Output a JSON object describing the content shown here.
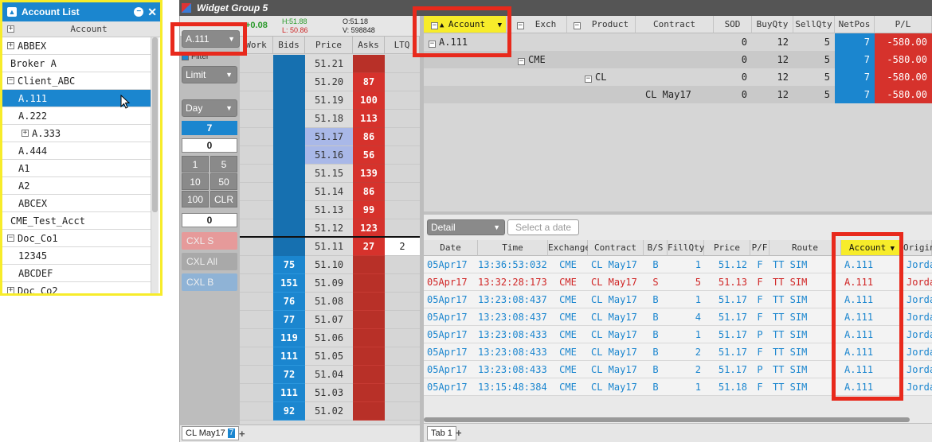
{
  "account_list": {
    "title": "Account List",
    "column": "Account",
    "rows": [
      {
        "label": "ABBEX",
        "level": 0,
        "toggle": "+"
      },
      {
        "label": "Broker A",
        "level": 0,
        "toggle": ""
      },
      {
        "label": "Client_ABC",
        "level": 0,
        "toggle": "−"
      },
      {
        "label": "A.111",
        "level": 1,
        "toggle": "",
        "selected": true
      },
      {
        "label": "A.222",
        "level": 1,
        "toggle": ""
      },
      {
        "label": "A.333",
        "level": 1,
        "toggle": "+"
      },
      {
        "label": "A.444",
        "level": 1,
        "toggle": ""
      },
      {
        "label": "A1",
        "level": 1,
        "toggle": ""
      },
      {
        "label": "A2",
        "level": 1,
        "toggle": ""
      },
      {
        "label": "ABCEX",
        "level": 1,
        "toggle": ""
      },
      {
        "label": "CME_Test_Acct",
        "level": 0,
        "toggle": ""
      },
      {
        "label": "Doc_Co1",
        "level": 0,
        "toggle": "−"
      },
      {
        "label": "12345",
        "level": 1,
        "toggle": ""
      },
      {
        "label": "ABCDEF",
        "level": 1,
        "toggle": ""
      },
      {
        "label": "Doc_Co2",
        "level": 0,
        "toggle": "+"
      }
    ]
  },
  "widget": {
    "title": "Widget Group 5"
  },
  "md": {
    "change": "+0.08",
    "high": "H:51.88",
    "low": "L: 50.86",
    "open": "O:51.18",
    "volume": "V: 598848",
    "account": "A.111",
    "filter": "Filter",
    "order_type": "Limit",
    "tif": "Day",
    "qty": "7",
    "disclosed": "0",
    "quick_qty": [
      "1",
      "5",
      "10",
      "50",
      "100",
      "CLR"
    ],
    "qty2": "0",
    "cxl_s": "CXL S",
    "cxl_all": "CXL All",
    "cxl_b": "CXL B",
    "headers": [
      "Work",
      "Bids",
      "Price",
      "Asks",
      "LTQ"
    ],
    "ladder": [
      {
        "price": "51.21",
        "bid": "",
        "ask": ""
      },
      {
        "price": "51.20",
        "bid": "",
        "ask": "87"
      },
      {
        "price": "51.19",
        "bid": "",
        "ask": "100"
      },
      {
        "price": "51.18",
        "bid": "",
        "ask": "113"
      },
      {
        "price": "51.17",
        "bid": "",
        "ask": "86"
      },
      {
        "price": "51.16",
        "bid": "",
        "ask": "56"
      },
      {
        "price": "51.15",
        "bid": "",
        "ask": "139"
      },
      {
        "price": "51.14",
        "bid": "",
        "ask": "86"
      },
      {
        "price": "51.13",
        "bid": "",
        "ask": "99"
      },
      {
        "price": "51.12",
        "bid": "",
        "ask": "123"
      },
      {
        "price": "51.11",
        "bid": "",
        "ask": "27",
        "ltq": "2"
      },
      {
        "price": "51.10",
        "bid": "75",
        "ask": ""
      },
      {
        "price": "51.09",
        "bid": "151",
        "ask": ""
      },
      {
        "price": "51.08",
        "bid": "76",
        "ask": ""
      },
      {
        "price": "51.07",
        "bid": "77",
        "ask": ""
      },
      {
        "price": "51.06",
        "bid": "119",
        "ask": ""
      },
      {
        "price": "51.05",
        "bid": "111",
        "ask": ""
      },
      {
        "price": "51.04",
        "bid": "72",
        "ask": ""
      },
      {
        "price": "51.03",
        "bid": "111",
        "ask": ""
      },
      {
        "price": "51.02",
        "bid": "92",
        "ask": ""
      }
    ],
    "tab": "CL May17",
    "tab_badge": "7"
  },
  "positions": {
    "headers": [
      "Account",
      "Exch",
      "Product",
      "Contract",
      "SOD",
      "BuyQty",
      "SellQty",
      "NetPos",
      "P/L"
    ],
    "rows": [
      {
        "account": "A.111",
        "exch": "",
        "product": "",
        "contract": "",
        "sod": "0",
        "buy": "12",
        "sell": "5",
        "net": "7",
        "pl": "-580.00"
      },
      {
        "account": "",
        "exch": "CME",
        "product": "",
        "contract": "",
        "sod": "0",
        "buy": "12",
        "sell": "5",
        "net": "7",
        "pl": "-580.00"
      },
      {
        "account": "",
        "exch": "",
        "product": "CL",
        "contract": "",
        "sod": "0",
        "buy": "12",
        "sell": "5",
        "net": "7",
        "pl": "-580.00"
      },
      {
        "account": "",
        "exch": "",
        "product": "",
        "contract": "CL May17",
        "sod": "0",
        "buy": "12",
        "sell": "5",
        "net": "7",
        "pl": "-580.00"
      }
    ]
  },
  "fills": {
    "view": "Detail",
    "date_placeholder": "Select a date",
    "headers": [
      "Date",
      "Time",
      "Exchange",
      "Contract",
      "B/S",
      "FillQty",
      "Price",
      "P/F",
      "Route",
      "Account",
      "Origin"
    ],
    "rows": [
      {
        "date": "05Apr17",
        "time": "13:36:53:032",
        "exch": "CME",
        "contract": "CL May17",
        "bs": "B",
        "qty": "1",
        "price": "51.12",
        "pf": "F",
        "route": "TT SIM",
        "account": "A.111",
        "origin": "Jorda",
        "red": false
      },
      {
        "date": "05Apr17",
        "time": "13:32:28:173",
        "exch": "CME",
        "contract": "CL May17",
        "bs": "S",
        "qty": "5",
        "price": "51.13",
        "pf": "F",
        "route": "TT SIM",
        "account": "A.111",
        "origin": "Jorda",
        "red": true
      },
      {
        "date": "05Apr17",
        "time": "13:23:08:437",
        "exch": "CME",
        "contract": "CL May17",
        "bs": "B",
        "qty": "1",
        "price": "51.17",
        "pf": "F",
        "route": "TT SIM",
        "account": "A.111",
        "origin": "Jorda",
        "red": false
      },
      {
        "date": "05Apr17",
        "time": "13:23:08:437",
        "exch": "CME",
        "contract": "CL May17",
        "bs": "B",
        "qty": "4",
        "price": "51.17",
        "pf": "F",
        "route": "TT SIM",
        "account": "A.111",
        "origin": "Jorda",
        "red": false
      },
      {
        "date": "05Apr17",
        "time": "13:23:08:433",
        "exch": "CME",
        "contract": "CL May17",
        "bs": "B",
        "qty": "1",
        "price": "51.17",
        "pf": "P",
        "route": "TT SIM",
        "account": "A.111",
        "origin": "Jorda",
        "red": false
      },
      {
        "date": "05Apr17",
        "time": "13:23:08:433",
        "exch": "CME",
        "contract": "CL May17",
        "bs": "B",
        "qty": "2",
        "price": "51.17",
        "pf": "F",
        "route": "TT SIM",
        "account": "A.111",
        "origin": "Jorda",
        "red": false
      },
      {
        "date": "05Apr17",
        "time": "13:23:08:433",
        "exch": "CME",
        "contract": "CL May17",
        "bs": "B",
        "qty": "2",
        "price": "51.17",
        "pf": "P",
        "route": "TT SIM",
        "account": "A.111",
        "origin": "Jorda",
        "red": false
      },
      {
        "date": "05Apr17",
        "time": "13:15:48:384",
        "exch": "CME",
        "contract": "CL May17",
        "bs": "B",
        "qty": "1",
        "price": "51.18",
        "pf": "F",
        "route": "TT SIM",
        "account": "A.111",
        "origin": "Jorda",
        "red": false
      }
    ],
    "tab": "Tab 1"
  },
  "colors": {
    "accent": "#1b86cf",
    "ask": "#d6322c",
    "highlight": "#f7ec2a",
    "callout": "#e8291c"
  },
  "icons": [
    "add-icon",
    "minimize-icon",
    "close-icon",
    "dropdown-icon",
    "filter-icon",
    "sort-asc-icon",
    "expand-icon",
    "collapse-icon",
    "pointer-cursor-icon"
  ]
}
